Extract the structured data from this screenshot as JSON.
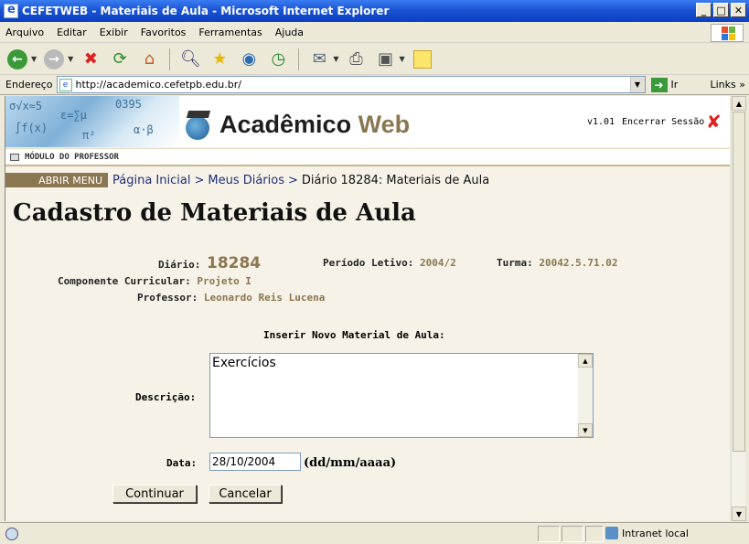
{
  "window": {
    "title": "CEFETWEB - Materiais de Aula - Microsoft Internet Explorer",
    "minimize": "_",
    "maximize": "□",
    "close": "✕"
  },
  "menubar": {
    "items": [
      "Arquivo",
      "Editar",
      "Exibir",
      "Favoritos",
      "Ferramentas",
      "Ajuda"
    ]
  },
  "addressbar": {
    "label": "Endereço",
    "url": "http://academico.cefetpb.edu.br/",
    "go": "Ir",
    "links": "Links"
  },
  "banner": {
    "brand_main": "Acadêmico",
    "brand_accent": "Web",
    "version": "v1.01",
    "logout": "Encerrar Sessão",
    "module": "MÓDULO DO PROFESSOR"
  },
  "nav": {
    "menu_button": "ABRIR MENU",
    "crumbs": [
      "Página Inicial",
      "Meus Diários"
    ],
    "current": "Diário 18284: Materiais de Aula",
    "separator": ">"
  },
  "page": {
    "title": "Cadastro de Materiais de Aula"
  },
  "info": {
    "diario_label": "Diário:",
    "diario_value": "18284",
    "periodo_label": "Período Letivo:",
    "periodo_value": "2004/2",
    "turma_label": "Turma:",
    "turma_value": "20042.5.71.02",
    "componente_label": "Componente Curricular:",
    "componente_value": "Projeto I",
    "professor_label": "Professor:",
    "professor_value": "Leonardo Reis Lucena"
  },
  "form": {
    "heading": "Inserir Novo Material de Aula:",
    "descricao_label": "Descrição:",
    "descricao_value": "Exercícios",
    "data_label": "Data:",
    "data_value": "28/10/2004",
    "data_format": "(dd/mm/aaaa)",
    "continuar": "Continuar",
    "cancelar": "Cancelar"
  },
  "status": {
    "zone": "Intranet local"
  }
}
